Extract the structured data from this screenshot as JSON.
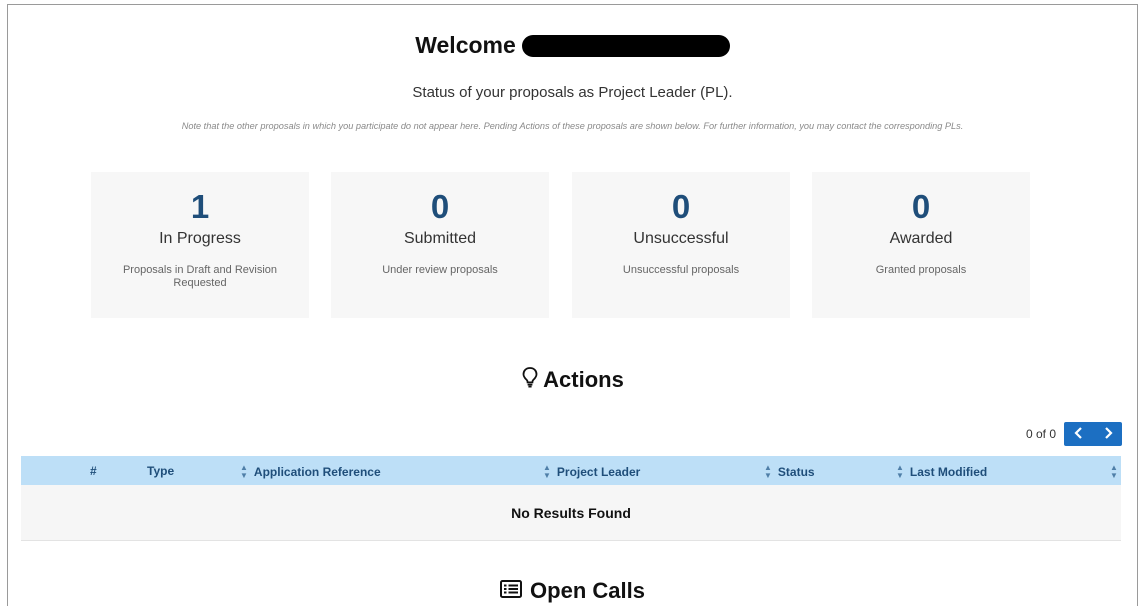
{
  "welcome": {
    "text": "Welcome"
  },
  "status_title": "Status of your proposals as Project Leader (PL).",
  "note": "Note that the other proposals in which you participate do not appear here. Pending Actions of these proposals are shown below. For further information, you may contact the corresponding PLs.",
  "cards": [
    {
      "count": "1",
      "label": "In Progress",
      "desc": "Proposals in Draft and Revision Requested"
    },
    {
      "count": "0",
      "label": "Submitted",
      "desc": "Under review proposals"
    },
    {
      "count": "0",
      "label": "Unsuccessful",
      "desc": "Unsuccessful proposals"
    },
    {
      "count": "0",
      "label": "Awarded",
      "desc": "Granted proposals"
    }
  ],
  "actions": {
    "heading": "Actions",
    "icon": "lightbulb-icon",
    "pager": {
      "text": "0 of 0",
      "prev": "‹",
      "next": "›"
    },
    "columns": {
      "num": "#",
      "type": "Type",
      "ref": "Application Reference",
      "leader": "Project Leader",
      "status": "Status",
      "modified": "Last Modified"
    },
    "empty": "No Results Found"
  },
  "open_calls": {
    "heading": "Open Calls",
    "icon": "list-icon"
  },
  "colors": {
    "accent": "#1c6fc2",
    "count": "#1f4e7a",
    "table_header": "#bddff7"
  }
}
